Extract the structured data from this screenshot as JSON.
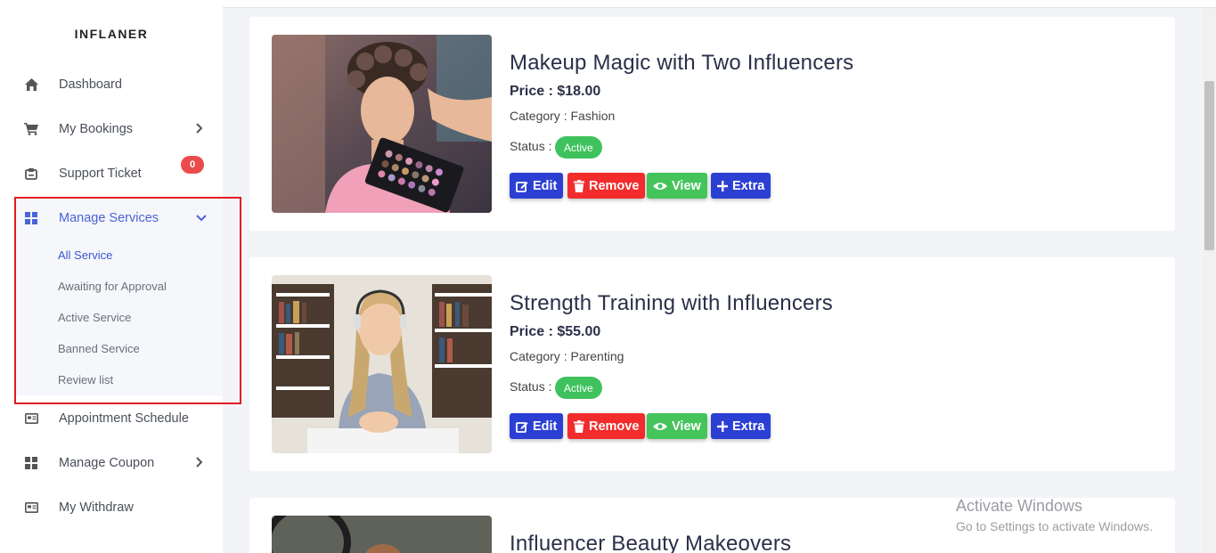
{
  "brand": "INFLANER",
  "sidebar": {
    "items": [
      {
        "label": "Dashboard",
        "icon": "home-icon"
      },
      {
        "label": "My Bookings",
        "icon": "cart-icon"
      },
      {
        "label": "Support Ticket",
        "icon": "ticket-icon",
        "badge": "0"
      },
      {
        "label": "Manage Services",
        "icon": "grid-icon"
      },
      {
        "label": "Appointment Schedule",
        "icon": "card-icon"
      },
      {
        "label": "Manage Coupon",
        "icon": "grid-icon"
      },
      {
        "label": "My Withdraw",
        "icon": "card-icon"
      }
    ],
    "submenu": [
      {
        "label": "All Service"
      },
      {
        "label": "Awaiting for Approval"
      },
      {
        "label": "Active Service"
      },
      {
        "label": "Banned Service"
      },
      {
        "label": "Review list"
      }
    ]
  },
  "services": [
    {
      "title": "Makeup Magic with Two Influencers",
      "price": "Price : $18.00",
      "category": "Category : Fashion",
      "status_label": "Status :",
      "status": "Active"
    },
    {
      "title": "Strength Training with Influencers",
      "price": "Price : $55.00",
      "category": "Category : Parenting",
      "status_label": "Status :",
      "status": "Active"
    },
    {
      "title": "Influencer Beauty Makeovers"
    }
  ],
  "buttons": {
    "edit": "Edit",
    "remove": "Remove",
    "view": "View",
    "extra": "Extra"
  },
  "watermark": {
    "line1": "Activate Windows",
    "line2": "Go to Settings to activate Windows."
  },
  "colors": {
    "accent": "#3c56d1",
    "edit": "#2c3fd3",
    "remove": "#f22c2c",
    "view": "#45c45c",
    "active_badge": "#3fc25e",
    "highlight_border": "#e31b23"
  }
}
